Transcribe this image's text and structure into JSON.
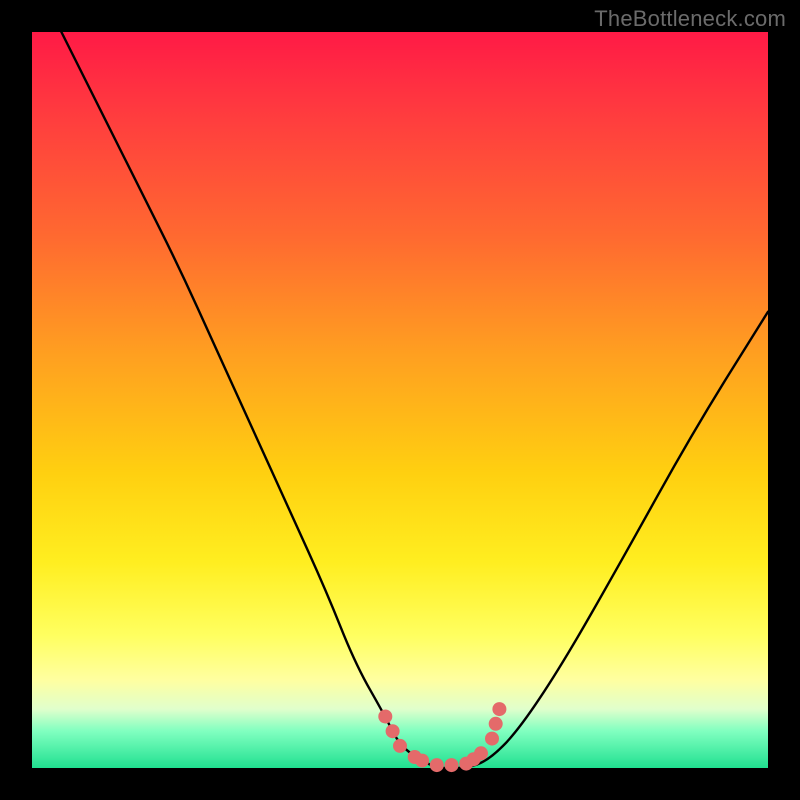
{
  "watermark": "TheBottleneck.com",
  "chart_data": {
    "type": "line",
    "title": "",
    "xlabel": "",
    "ylabel": "",
    "xlim": [
      0,
      100
    ],
    "ylim": [
      0,
      100
    ],
    "grid": false,
    "series": [
      {
        "name": "bottleneck-curve",
        "x": [
          4,
          10,
          15,
          20,
          25,
          30,
          35,
          40,
          44,
          48,
          50,
          53,
          55,
          57,
          59,
          62,
          66,
          72,
          80,
          90,
          100
        ],
        "y": [
          100,
          88,
          78,
          68,
          57,
          46,
          35,
          24,
          14,
          7,
          3,
          1,
          0,
          0,
          0,
          1,
          5,
          14,
          28,
          46,
          62
        ]
      }
    ],
    "markers": {
      "name": "highlight-dots",
      "color": "#e46a6a",
      "points": [
        {
          "x": 48,
          "y": 7
        },
        {
          "x": 49,
          "y": 5
        },
        {
          "x": 50,
          "y": 3
        },
        {
          "x": 52,
          "y": 1.5
        },
        {
          "x": 53,
          "y": 1
        },
        {
          "x": 55,
          "y": 0.4
        },
        {
          "x": 57,
          "y": 0.4
        },
        {
          "x": 59,
          "y": 0.6
        },
        {
          "x": 60,
          "y": 1.2
        },
        {
          "x": 61,
          "y": 2
        },
        {
          "x": 62.5,
          "y": 4
        },
        {
          "x": 63,
          "y": 6
        },
        {
          "x": 63.5,
          "y": 8
        }
      ]
    },
    "gradient_stops": {
      "top": "#ff1a46",
      "mid_upper": "#ff6a30",
      "mid": "#ffd010",
      "mid_lower": "#ffff60",
      "bottom": "#20e090"
    }
  }
}
